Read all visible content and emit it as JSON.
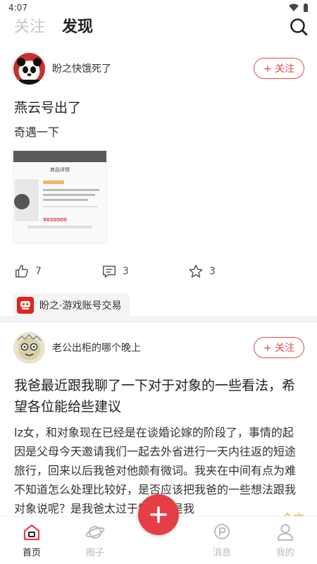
{
  "status_bar": {
    "time": "4:07"
  },
  "header": {
    "tabs": [
      {
        "label": "关注",
        "active": false
      },
      {
        "label": "发现",
        "active": true
      }
    ]
  },
  "posts": [
    {
      "author": "盼之快饿死了",
      "follow_label": "+ 关注",
      "title": "燕云号出了",
      "body": "奇遇一下",
      "thumbnail": {
        "title": "商品详情",
        "price": "¥650000"
      },
      "likes": "7",
      "comments": "3",
      "favorites": "3",
      "circle": "盼之·游戏账号交易"
    },
    {
      "author": "老公出柜的哪个晚上",
      "follow_label": "+ 关注",
      "title": "我爸最近跟我聊了一下对于对象的一些看法，希望各位能给些建议",
      "body": "lz女，和对象现在已经是在谈婚论嫁的阶段了，事情的起因是父母今天邀请我们一起去外省进行一天内往返的短途旅行，回来以后我爸对他颇有微词。我夹在中间有点为难不知道怎么处理比较好，是否应该把我爸的一些想法跟我对象说呢？是我爸太过于敏感还是我",
      "more_label": "...全文"
    }
  ],
  "bottom_nav": {
    "items": [
      {
        "label": "首页",
        "active": true
      },
      {
        "label": "圈子",
        "active": false
      },
      {
        "label": "消息",
        "active": false
      },
      {
        "label": "我的",
        "active": false
      }
    ]
  },
  "colors": {
    "accent": "#e63e45",
    "follow": "#e44a4a",
    "more": "#e6a23c"
  }
}
